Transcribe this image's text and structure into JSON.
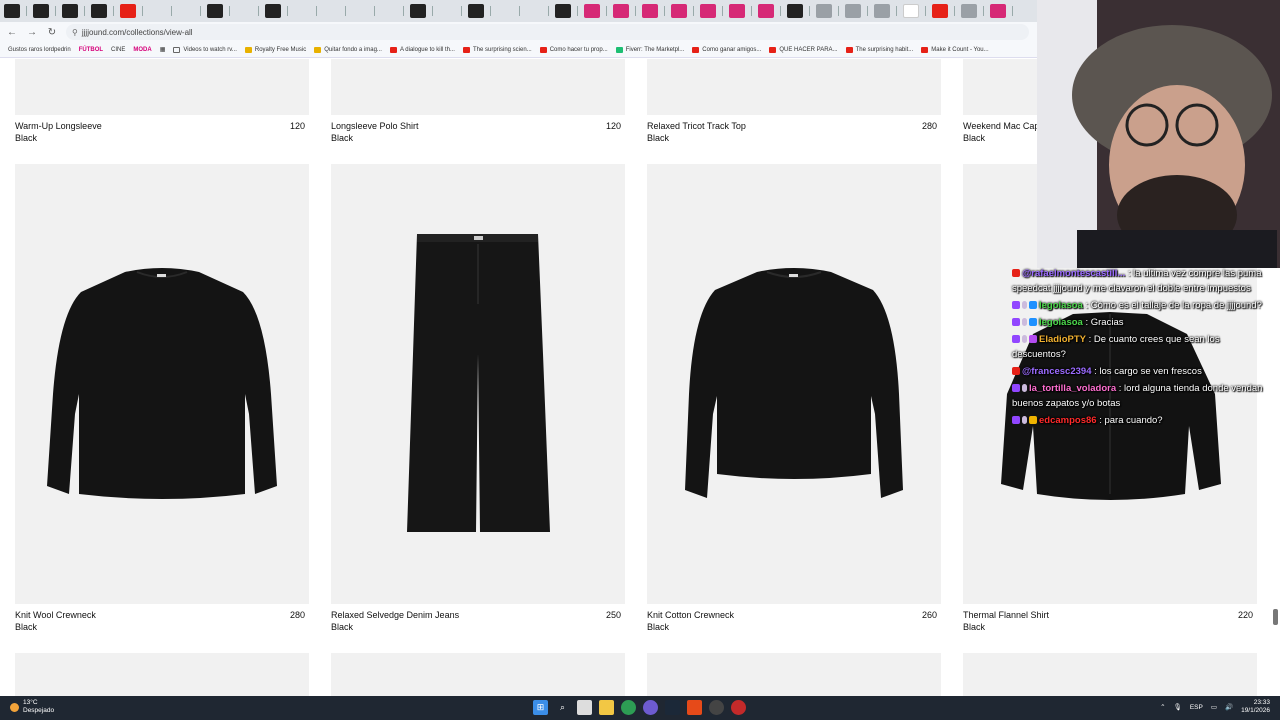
{
  "browser": {
    "url": "jjjjound.com/collections/view-all",
    "bookmarks": [
      {
        "label": "Gustos raros lordpedrin",
        "style": "plain",
        "icon": ""
      },
      {
        "label": "FÚTBOL",
        "style": "tag",
        "icon": ""
      },
      {
        "label": "CINE",
        "style": "tag-plain",
        "icon": ""
      },
      {
        "label": "MODA",
        "style": "tag",
        "icon": ""
      },
      {
        "label": "Videos to watch rv...",
        "style": "plain",
        "icon": "folder"
      },
      {
        "label": "Royalty Free Music",
        "style": "plain",
        "icon": "yellow"
      },
      {
        "label": "Quitar fondo a imag...",
        "style": "plain",
        "icon": "yellow"
      },
      {
        "label": "A dialogue to kill th...",
        "style": "plain",
        "icon": "red"
      },
      {
        "label": "The surprising scien...",
        "style": "plain",
        "icon": "red"
      },
      {
        "label": "Como hacer tu prop...",
        "style": "plain",
        "icon": "red"
      },
      {
        "label": "Fiverr: The Marketpl...",
        "style": "plain",
        "icon": "green"
      },
      {
        "label": "Como ganar amigos...",
        "style": "plain",
        "icon": "red"
      },
      {
        "label": "QUE HACER PARA...",
        "style": "plain",
        "icon": "red"
      },
      {
        "label": "The surprising habit...",
        "style": "plain",
        "icon": "red"
      },
      {
        "label": "Make it Count - You...",
        "style": "plain",
        "icon": "red"
      }
    ]
  },
  "products_row1": [
    {
      "name": "Warm-Up Longsleeve",
      "price": "120",
      "color": "Black"
    },
    {
      "name": "Longsleeve Polo Shirt",
      "price": "120",
      "color": "Black"
    },
    {
      "name": "Relaxed Tricot Track Top",
      "price": "280",
      "color": "Black"
    },
    {
      "name": "Weekend Mac Cap",
      "price": "",
      "color": "Black"
    }
  ],
  "products_row2": [
    {
      "name": "Knit Wool Crewneck",
      "price": "280",
      "color": "Black"
    },
    {
      "name": "Relaxed Selvedge Denim Jeans",
      "price": "250",
      "color": "Black"
    },
    {
      "name": "Knit Cotton Crewneck",
      "price": "260",
      "color": "Black"
    },
    {
      "name": "Thermal Flannel Shirt",
      "price": "220",
      "color": "Black"
    }
  ],
  "chat": [
    {
      "badges": [
        "yt"
      ],
      "user": "@rafaelmontescastill...",
      "user_color": "#9b6bff",
      "text": "la ultima vez compre las puma speedcat jjjjound y me clavaron el doble entre impuestos"
    },
    {
      "badges": [
        "tw",
        "mic",
        "sub"
      ],
      "user": "legolasoa",
      "user_color": "#4cd94c",
      "text": "Cómo es el tallaje de la ropa de jjjjound?"
    },
    {
      "badges": [
        "tw",
        "mic",
        "sub"
      ],
      "user": "legolasoa",
      "user_color": "#4cd94c",
      "text": "Gracias"
    },
    {
      "badges": [
        "tw",
        "mic",
        "pur"
      ],
      "user": "EladioPTY",
      "user_color": "#f0b030",
      "text": "De cuanto crees que sean los descuentos?"
    },
    {
      "badges": [
        "yt"
      ],
      "user": "@francesc2394",
      "user_color": "#9b6bff",
      "text": "los cargo se ven frescos"
    },
    {
      "badges": [
        "tw",
        "mic"
      ],
      "user": "la_tortilla_voladora",
      "user_color": "#ff6fd0",
      "text": "lord alguna tienda donde vendan buenos zapatos y/o botas"
    },
    {
      "badges": [
        "tw",
        "mic",
        "crown"
      ],
      "user": "edcampos86",
      "user_color": "#ff2a2a",
      "text": "para cuando?"
    }
  ],
  "taskbar": {
    "temperature": "13°C",
    "weather": "Despejado",
    "language": "ESP",
    "time": "23:33",
    "date": "19/1/2026"
  }
}
